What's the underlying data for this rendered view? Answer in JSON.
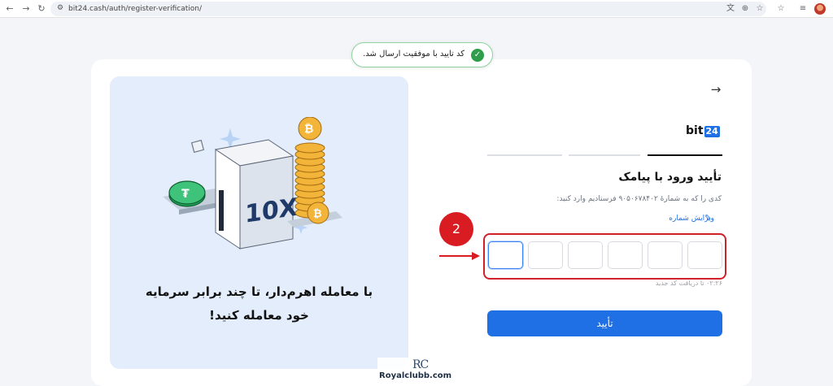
{
  "browser": {
    "url": "bit24.cash/auth/register-verification/",
    "back_glyph": "←",
    "forward_glyph": "→",
    "reload_glyph": "↻",
    "tune_glyph": "⚙",
    "translate_glyph": "文",
    "zoom_glyph": "⊕",
    "bookmark_glyph": "☆",
    "extensions_glyph": "☆",
    "menu_glyph": "≡"
  },
  "toast": {
    "message": "کد تایید با موفقیت ارسال شد.",
    "check_glyph": "✓"
  },
  "promo": {
    "line1": "با معامله اهرم‌دار، تا چند برابر سرمایه",
    "line2": "خود معامله کنید!",
    "multiplier": "10X",
    "token_symbol": "₮",
    "coin_symbol": "₿"
  },
  "form": {
    "back_glyph": "→",
    "logo_text": "bit",
    "logo_num": "24",
    "title": "تأیید ورود با پیامک",
    "description": "کدی را که به شمارهٔ ۹۰۵۰۶۷۸۴۰۲ فرستادیم وارد کنید:",
    "edit_label": "ویرایش شماره",
    "edit_glyph": "✎",
    "otp_values": [
      "",
      "",
      "",
      "",
      "",
      ""
    ],
    "resend_text": "۰۲:۲۶ تا دریافت کد جدید",
    "submit_label": "تأیید"
  },
  "annotation": {
    "step_number": "2"
  },
  "watermark": {
    "logo": "RC",
    "text": "Royalclubb.com"
  },
  "colors": {
    "primary": "#1f6fe5",
    "success": "#2e9e4a",
    "annotation_red": "#d91c22",
    "promo_bg": "#e3edfb"
  }
}
